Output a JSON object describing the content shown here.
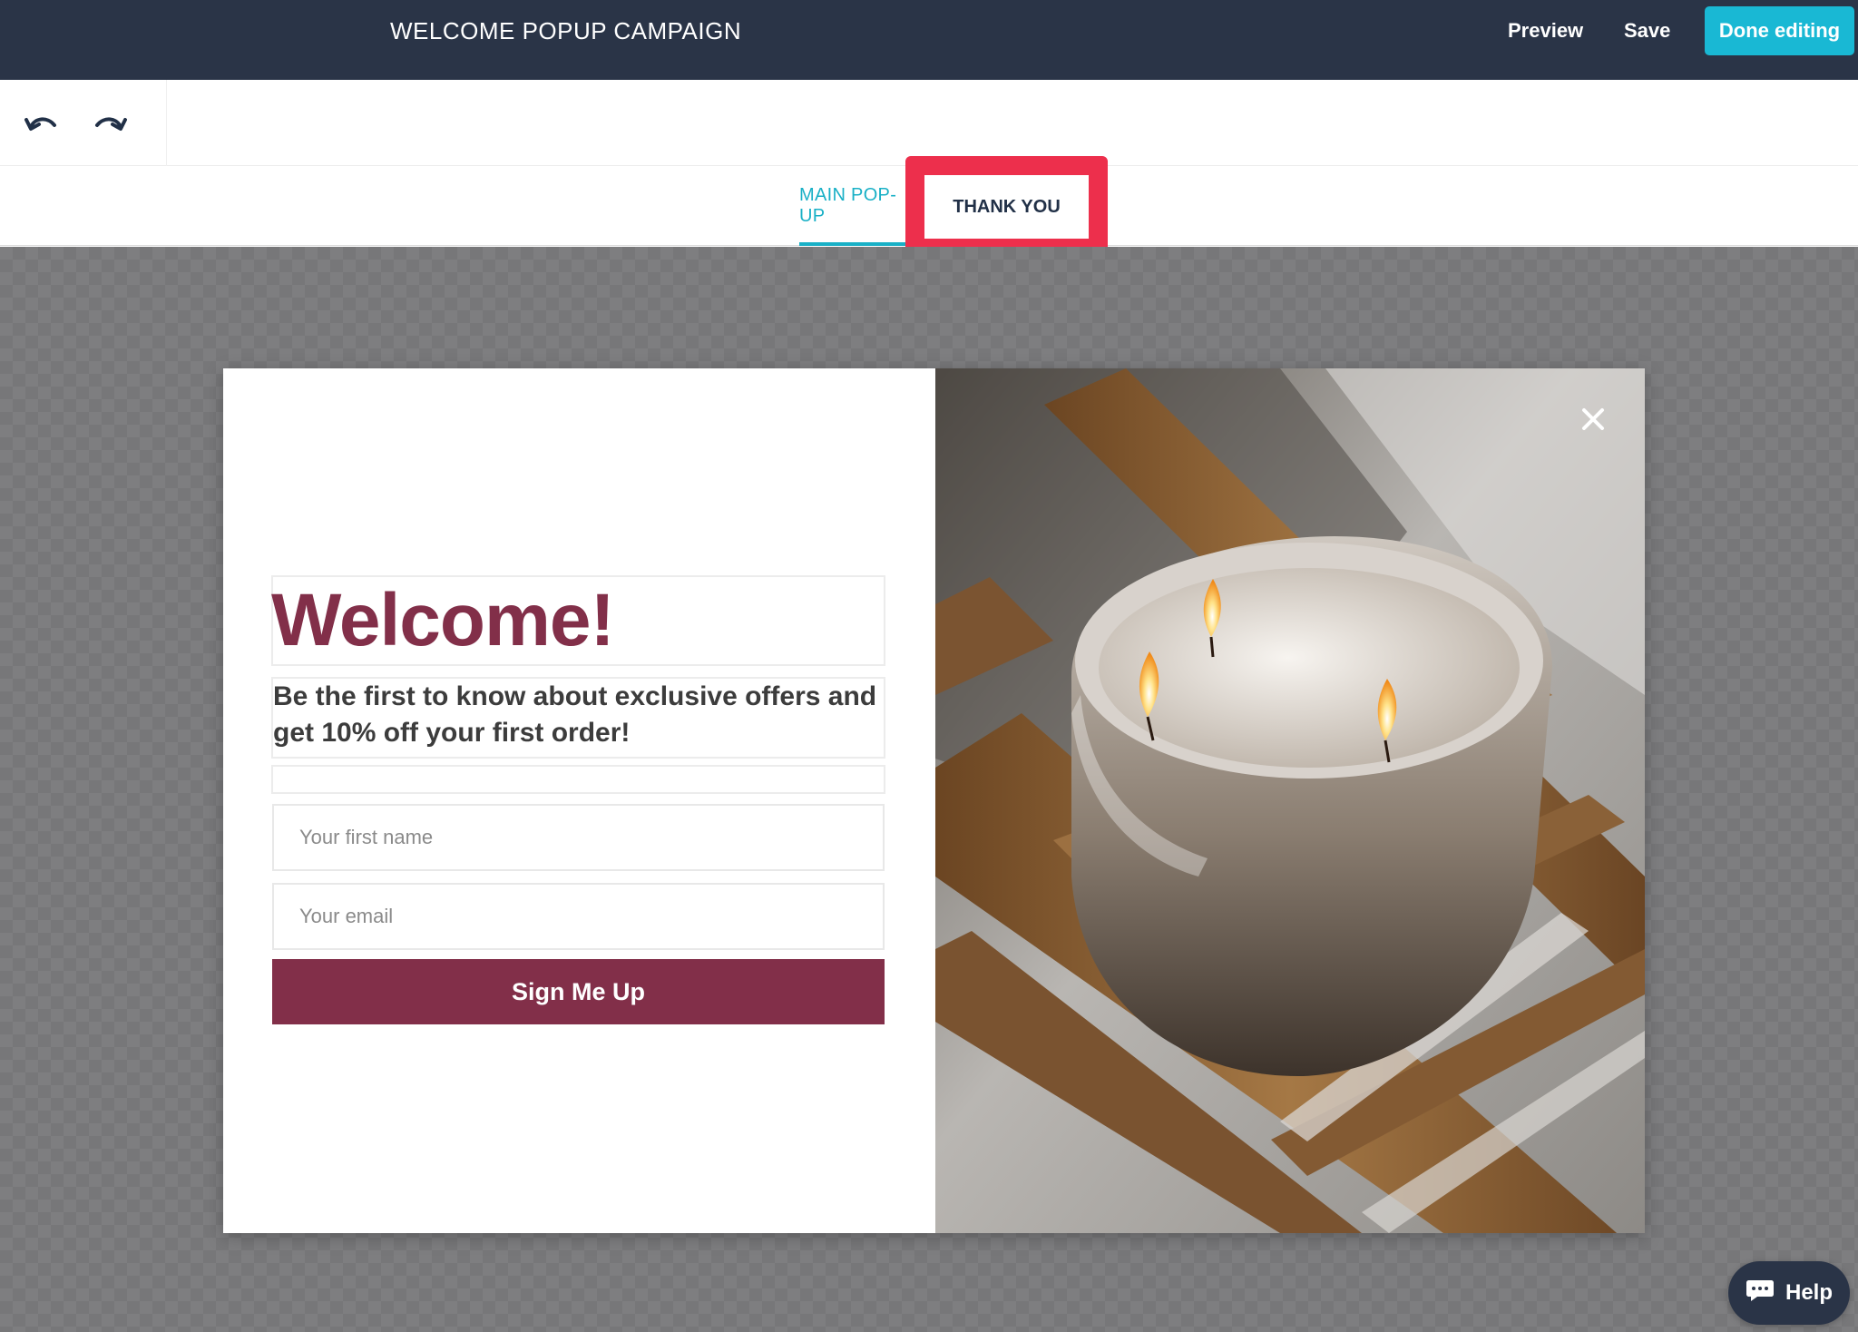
{
  "header": {
    "title": "WELCOME POPUP CAMPAIGN",
    "preview_label": "Preview",
    "save_label": "Save",
    "done_label": "Done editing"
  },
  "toolbar": {
    "undo_icon": "undo-icon",
    "redo_icon": "redo-icon"
  },
  "tabs": [
    {
      "label": "MAIN POP-UP",
      "active": true
    },
    {
      "label": "THANK YOU",
      "active": false,
      "highlighted": true
    }
  ],
  "popup": {
    "heading": "Welcome!",
    "subheading": "Be the first to know about exclusive offers and get 10% off your first order!",
    "first_name_placeholder": "Your first name",
    "email_placeholder": "Your email",
    "button_label": "Sign Me Up",
    "image_description_icon": "candle-photo",
    "close_icon": "close-icon"
  },
  "help": {
    "label": "Help",
    "icon": "chat-bubble-icon"
  },
  "colors": {
    "header_bg": "#2a3447",
    "accent": "#19b8d4",
    "brand": "#822f49",
    "highlight": "#ed2f4c"
  }
}
